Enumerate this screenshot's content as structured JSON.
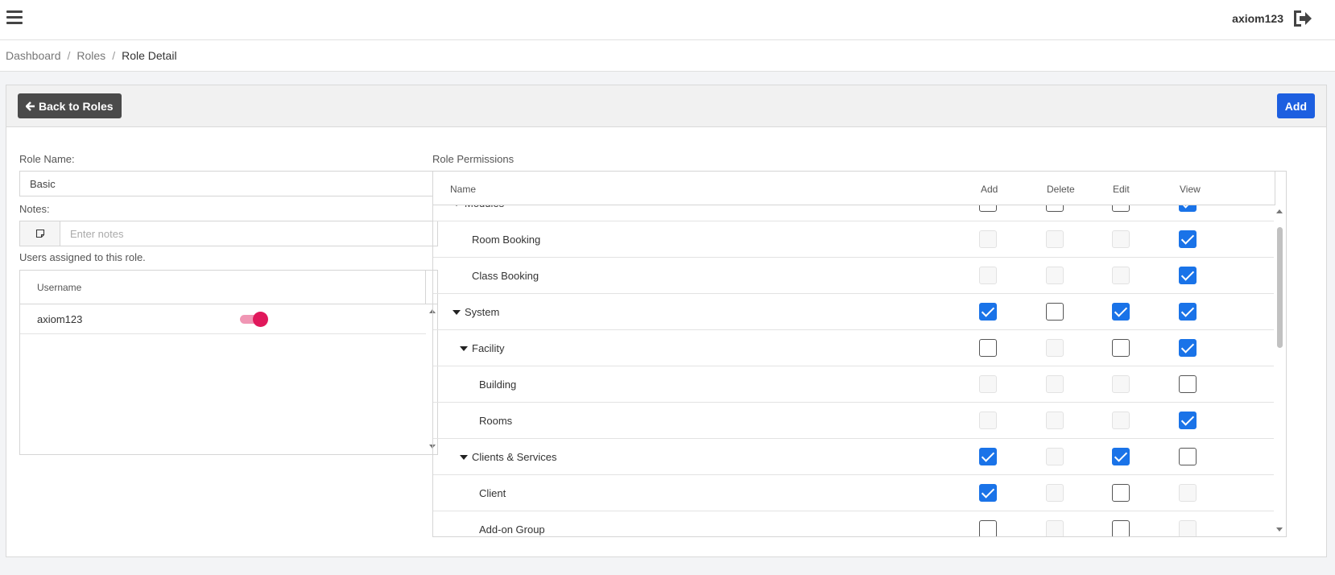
{
  "topbar": {
    "username": "axiom123"
  },
  "breadcrumb": {
    "items": [
      "Dashboard",
      "Roles"
    ],
    "current": "Role Detail",
    "separator": "/"
  },
  "panel": {
    "back_label": "Back to Roles",
    "add_label": "Add"
  },
  "form": {
    "role_name_label": "Role Name:",
    "role_name_value": "Basic",
    "notes_label": "Notes:",
    "notes_placeholder": "Enter notes",
    "users_label": "Users assigned to this role."
  },
  "users": {
    "column": "Username",
    "rows": [
      {
        "username": "axiom123",
        "active": true
      }
    ]
  },
  "permissions": {
    "title": "Role Permissions",
    "columns": [
      "Name",
      "Add",
      "Delete",
      "Edit",
      "View"
    ],
    "rows": [
      {
        "name": "Modules",
        "level": 0,
        "expandable": true,
        "add": "unchecked",
        "delete": "unchecked",
        "edit": "unchecked",
        "view": "checked"
      },
      {
        "name": "Room Booking",
        "level": 1,
        "expandable": false,
        "add": "disabled",
        "delete": "disabled",
        "edit": "disabled",
        "view": "checked"
      },
      {
        "name": "Class Booking",
        "level": 1,
        "expandable": false,
        "add": "disabled",
        "delete": "disabled",
        "edit": "disabled",
        "view": "checked"
      },
      {
        "name": "System",
        "level": 0,
        "expandable": true,
        "add": "checked",
        "delete": "unchecked",
        "edit": "checked",
        "view": "checked"
      },
      {
        "name": "Facility",
        "level": 1,
        "expandable": true,
        "add": "unchecked",
        "delete": "disabled",
        "edit": "unchecked",
        "view": "checked"
      },
      {
        "name": "Building",
        "level": 2,
        "expandable": false,
        "add": "disabled",
        "delete": "disabled",
        "edit": "disabled",
        "view": "unchecked"
      },
      {
        "name": "Rooms",
        "level": 2,
        "expandable": false,
        "add": "disabled",
        "delete": "disabled",
        "edit": "disabled",
        "view": "checked"
      },
      {
        "name": "Clients & Services",
        "level": 1,
        "expandable": true,
        "add": "checked",
        "delete": "disabled",
        "edit": "checked",
        "view": "unchecked"
      },
      {
        "name": "Client",
        "level": 2,
        "expandable": false,
        "add": "checked",
        "delete": "disabled",
        "edit": "unchecked",
        "view": "disabled"
      },
      {
        "name": "Add-on Group",
        "level": 2,
        "expandable": false,
        "add": "unchecked",
        "delete": "disabled",
        "edit": "unchecked",
        "view": "disabled"
      }
    ]
  },
  "colors": {
    "primary": "#1d5fe0",
    "checkbox": "#1a73e8",
    "toggle": "#e0185b",
    "back_button": "#4a4a4a"
  }
}
